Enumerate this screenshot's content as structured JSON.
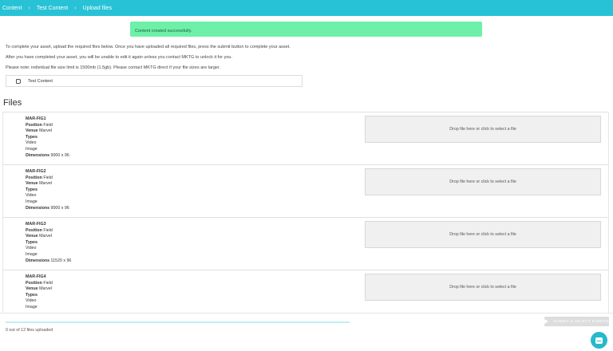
{
  "breadcrumb": {
    "items": [
      "Content",
      "Test Content",
      "Upload files"
    ],
    "separator": "›"
  },
  "toast": {
    "message": "Content created successfully."
  },
  "instructions": {
    "line1": "To complete your asset, upload the required files below. Once you have uploaded all required files, press the submit button to complete your asset.",
    "line2": "After you have completed your asset, you will be unable to edit it again unless you contact MKTG to unlock it for you.",
    "line3": "Please note: individual file size limit is 1500mb (1.5gb). Please contact MKTG direct if your file sizes are larger."
  },
  "content_tag": {
    "label": "Test Content",
    "icon": "tag-icon"
  },
  "files": {
    "title": "Files",
    "labels": {
      "position": "Position",
      "venue": "Venue",
      "types": "Types",
      "dimensions": "Dimensions"
    },
    "dropzone_text": "Drop file here or click to select a file",
    "items": [
      {
        "name": "MAR-FIG1",
        "position": "Field",
        "venue": "Marvel",
        "types": [
          "Video",
          "Image"
        ],
        "dimensions": "9000 x 96"
      },
      {
        "name": "MAR-FIG2",
        "position": "Field",
        "venue": "Marvel",
        "types": [
          "Video",
          "Image"
        ],
        "dimensions": "9000 x 96"
      },
      {
        "name": "MAR-FIG3",
        "position": "Field",
        "venue": "Marvel",
        "types": [
          "Video",
          "Image"
        ],
        "dimensions": "11520 x 96"
      },
      {
        "name": "MAR-FIG4",
        "position": "Field",
        "venue": "Marvel",
        "types": [
          "Video",
          "Image"
        ],
        "dimensions": ""
      }
    ]
  },
  "progress": {
    "uploaded": 0,
    "total": 12,
    "text": "0 out of 12 files uploaded",
    "fraction": 0
  },
  "submit": {
    "label": "SUBMIT & SELECT EVENTS",
    "icon": "send-icon"
  },
  "chat": {
    "icon": "chat-icon"
  },
  "colors": {
    "header": "#28c2d6",
    "toast": "#6ef0a9",
    "accent": "#26b9cc"
  }
}
